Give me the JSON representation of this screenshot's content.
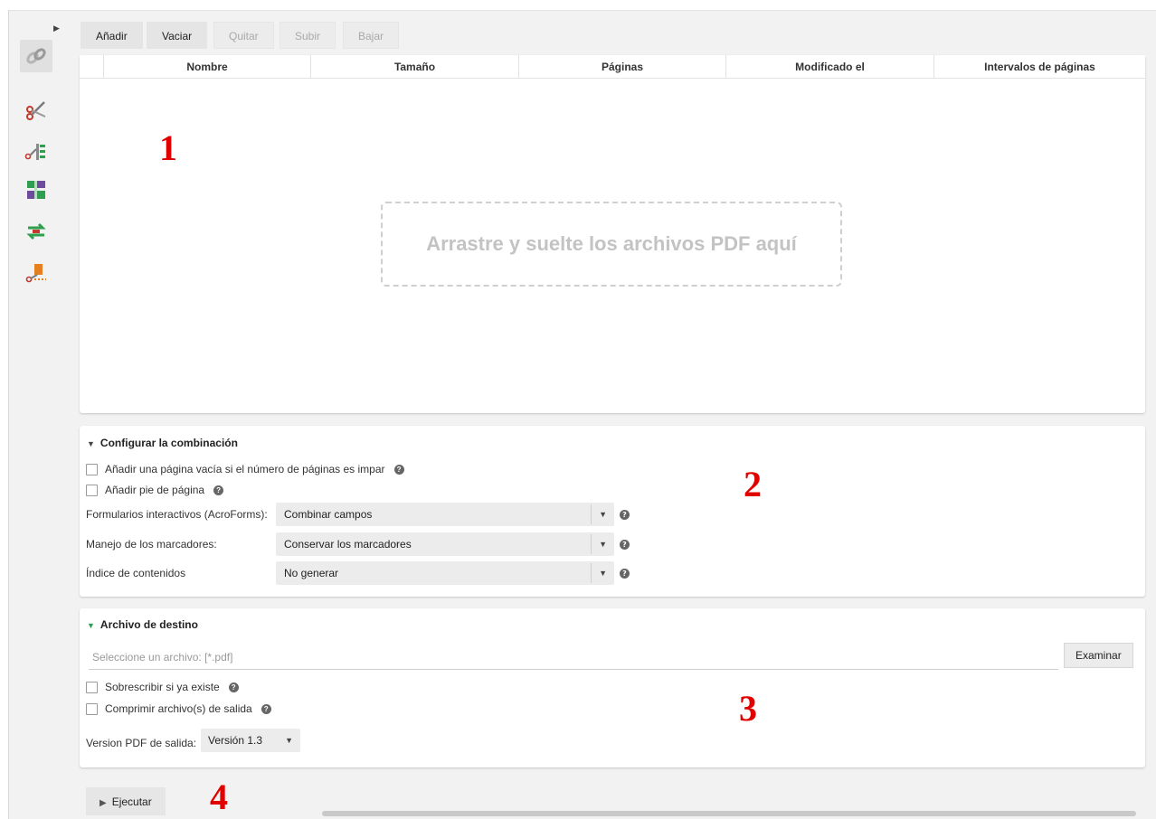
{
  "toolbar": {
    "add": "Añadir",
    "clear": "Vaciar",
    "remove": "Quitar",
    "move_up": "Subir",
    "move_down": "Bajar"
  },
  "table": {
    "columns": [
      "Nombre",
      "Tamaño",
      "Páginas",
      "Modificado el",
      "Intervalos de páginas"
    ],
    "drop_hint": "Arrastre y suelte los archivos PDF aquí"
  },
  "annotations": [
    "1",
    "2",
    "3",
    "4"
  ],
  "merge_settings": {
    "title": "Configurar la combinación",
    "blank_page_label": "Añadir una página vacía si el número de páginas es impar",
    "footer_label": "Añadir pie de página",
    "acroforms_label": "Formularios interactivos (AcroForms):",
    "acroforms_value": "Combinar campos",
    "bookmarks_label": "Manejo de los marcadores:",
    "bookmarks_value": "Conservar los marcadores",
    "toc_label": "Índice de contenidos",
    "toc_value": "No generar"
  },
  "destination": {
    "title": "Archivo de destino",
    "file_placeholder": "Seleccione un archivo: [*.pdf]",
    "browse": "Examinar",
    "overwrite_label": "Sobrescribir si ya existe",
    "compress_label": "Comprimir archivo(s) de salida",
    "version_label": "Version PDF de salida:",
    "version_value": "Versión 1.3"
  },
  "run": {
    "label": "Ejecutar"
  },
  "colors": {
    "accent_green": "#2e9e4f",
    "annotation_red": "#e00000"
  }
}
